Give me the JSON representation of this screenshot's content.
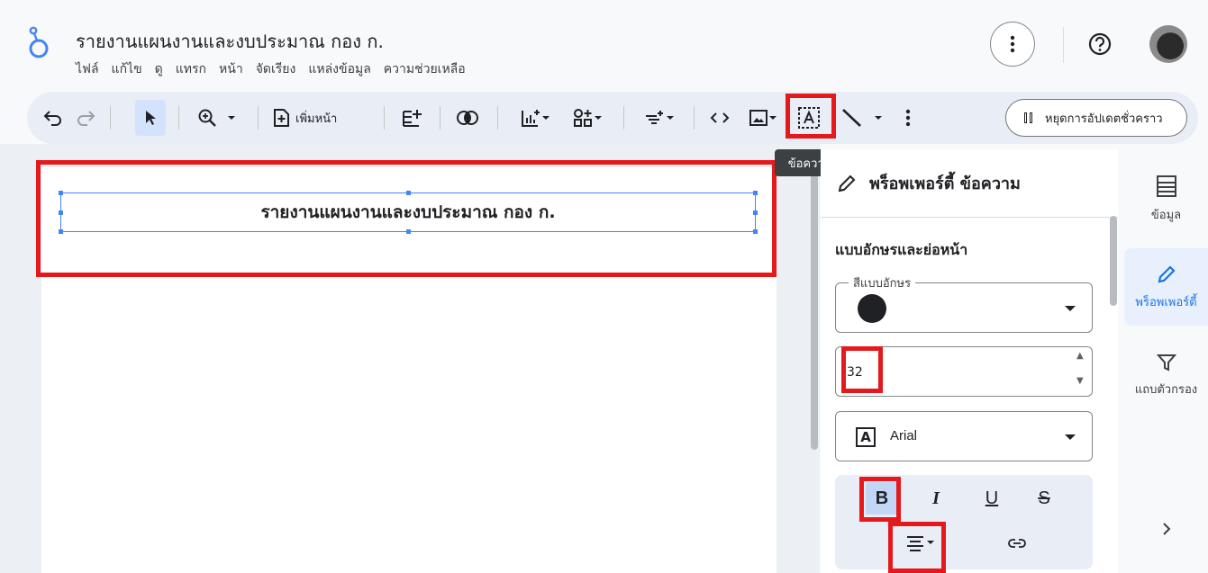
{
  "header": {
    "title": "รายงานแผนงานและงบประมาณ กอง ก.",
    "menu": [
      "ไฟล์",
      "แก้ไข",
      "ดู",
      "แทรก",
      "หน้า",
      "จัดเรียง",
      "แหล่งข้อมูล",
      "ความช่วยเหลือ"
    ]
  },
  "toolbar": {
    "add_page_label": "เพิ่มหน้า",
    "pause_updates_label": "หยุดการอัปเดตชั่วคราว",
    "tooltip": "ข้อความ"
  },
  "canvas": {
    "text_box_content": "รายงานแผนงานและงบประมาณ กอง ก."
  },
  "panel": {
    "title": "พร็อพเพอร์ตี้ ข้อความ",
    "section_title": "แบบอักษรและย่อหน้า",
    "font_color_label": "สีแบบอักษร",
    "font_color": "#202124",
    "font_size": "32",
    "font_family": "Arial",
    "format_buttons": [
      "B",
      "I",
      "U",
      "S"
    ]
  },
  "rail": {
    "items": [
      "ข้อมูล",
      "พร็อพเพอร์ตี้",
      "แถบตัวกรอง"
    ]
  },
  "colors": {
    "highlight": "#e5191c",
    "accent": "#1a73e8",
    "selection": "#4285f4"
  }
}
